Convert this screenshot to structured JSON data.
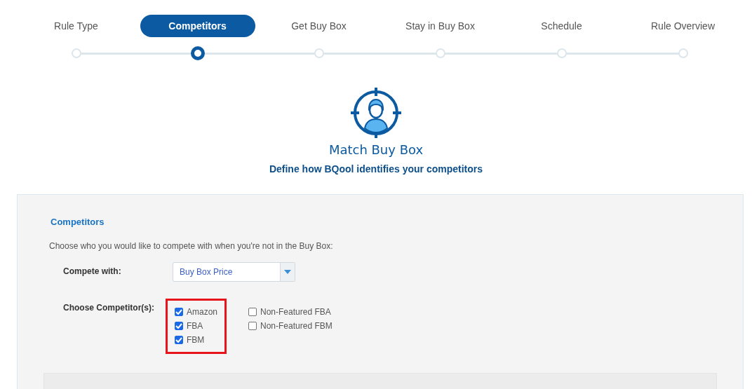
{
  "steps": [
    {
      "label": "Rule Type",
      "selected": false
    },
    {
      "label": "Competitors",
      "selected": true
    },
    {
      "label": "Get Buy Box",
      "selected": false
    },
    {
      "label": "Stay in Buy Box",
      "selected": false
    },
    {
      "label": "Schedule",
      "selected": false
    },
    {
      "label": "Rule Overview",
      "selected": false
    }
  ],
  "hero": {
    "title": "Match Buy Box",
    "subtitle": "Define how BQool identifies your competitors"
  },
  "panel": {
    "heading": "Competitors",
    "intro": "Choose who you would like to compete with when you're not in the Buy Box:",
    "compete_with": {
      "label": "Compete with:",
      "value": "Buy Box Price"
    },
    "competitors": {
      "label": "Choose Competitor(s):",
      "highlighted_options": [
        {
          "label": "Amazon",
          "checked": true
        },
        {
          "label": "FBA",
          "checked": true
        },
        {
          "label": "FBM",
          "checked": true
        }
      ],
      "other_options": [
        {
          "label": "Non-Featured FBA",
          "checked": false
        },
        {
          "label": "Non-Featured FBM",
          "checked": false
        }
      ]
    }
  }
}
